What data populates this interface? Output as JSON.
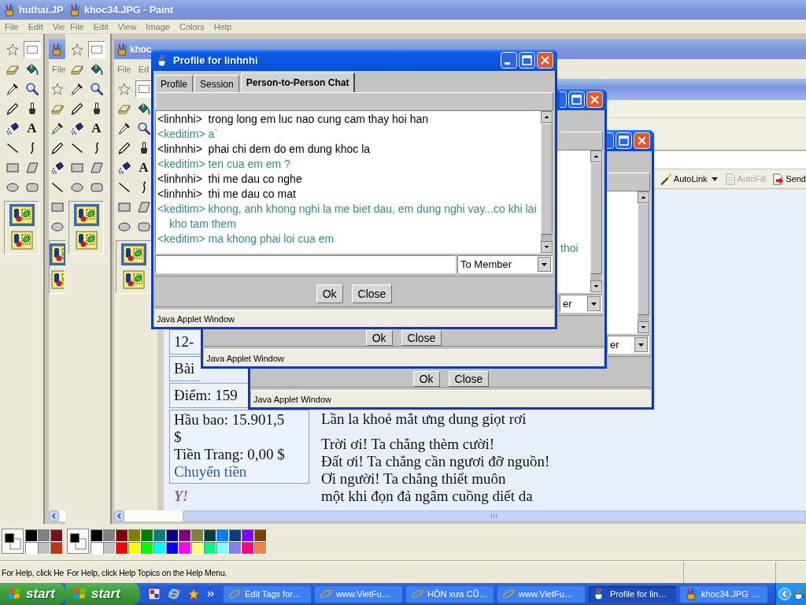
{
  "paint_windows": [
    {
      "title": "huthai.JP",
      "menu": [
        "File",
        "Edit",
        "Vie"
      ],
      "tools": [
        {
          "kind": "free-select",
          "selected": false
        },
        {
          "kind": "rect-select",
          "selected": true
        },
        {
          "kind": "eraser",
          "selected": false
        },
        {
          "kind": "fill",
          "selected": false
        },
        {
          "kind": "picker",
          "selected": false
        },
        {
          "kind": "magnifier",
          "selected": false
        },
        {
          "kind": "pencil",
          "selected": false
        },
        {
          "kind": "brush",
          "selected": false
        },
        {
          "kind": "airbrush",
          "selected": false
        },
        {
          "kind": "text",
          "glyph": "A",
          "selected": false
        },
        {
          "kind": "line",
          "selected": false
        },
        {
          "kind": "curve",
          "selected": false
        },
        {
          "kind": "rectangle",
          "selected": false
        },
        {
          "kind": "polygon",
          "selected": false
        },
        {
          "kind": "ellipse",
          "selected": false
        },
        {
          "kind": "rounded-rect",
          "selected": false
        }
      ],
      "options": [
        {
          "selected": true
        },
        {
          "selected": false
        }
      ],
      "nested_paint": {
        "menu": [
          "File"
        ],
        "tools": [
          {
            "kind": "free-select",
            "selected": false
          },
          {
            "kind": "eraser",
            "selected": false
          },
          {
            "kind": "picker",
            "selected": false
          },
          {
            "kind": "pencil",
            "selected": false
          },
          {
            "kind": "airbrush",
            "selected": false
          },
          {
            "kind": "line",
            "selected": false
          },
          {
            "kind": "rectangle",
            "selected": false
          },
          {
            "kind": "ellipse",
            "selected": false
          }
        ],
        "options": [
          {
            "selected": true
          },
          {
            "selected": false
          }
        ]
      },
      "palette": [
        {
          "color": "#000000"
        },
        {
          "color": "#808080"
        },
        {
          "color": "#701818"
        },
        {
          "color": "#ffffff"
        },
        {
          "color": "#c0c0c0"
        },
        {
          "color": "#c83214"
        }
      ],
      "status": "For Help, click He"
    },
    {
      "title": "khoc34.JPG - Paint",
      "menu": [
        "File",
        "Edit",
        "View",
        "Image",
        "Colors",
        "Help"
      ],
      "tools": [
        {
          "kind": "free-select",
          "selected": false
        },
        {
          "kind": "rect-select",
          "selected": true
        },
        {
          "kind": "eraser",
          "selected": false
        },
        {
          "kind": "fill",
          "selected": false
        },
        {
          "kind": "picker",
          "selected": false
        },
        {
          "kind": "magnifier",
          "selected": false
        },
        {
          "kind": "pencil",
          "selected": false
        },
        {
          "kind": "brush",
          "selected": false
        },
        {
          "kind": "airbrush",
          "selected": false
        },
        {
          "kind": "text",
          "glyph": "A",
          "selected": false
        },
        {
          "kind": "line",
          "selected": false
        },
        {
          "kind": "curve",
          "selected": false
        },
        {
          "kind": "rectangle",
          "selected": false
        },
        {
          "kind": "polygon",
          "selected": false
        },
        {
          "kind": "ellipse",
          "selected": false
        },
        {
          "kind": "rounded-rect",
          "selected": false
        }
      ],
      "options": [
        {
          "selected": true
        },
        {
          "selected": false
        }
      ],
      "nested_paint": {
        "title": "khoc",
        "menu": [
          "File",
          "Ed"
        ],
        "tools": [
          {
            "kind": "free-select",
            "selected": false
          },
          {
            "kind": "rect-select",
            "selected": true
          },
          {
            "kind": "eraser",
            "selected": false
          },
          {
            "kind": "fill",
            "selected": false
          },
          {
            "kind": "picker",
            "selected": false
          },
          {
            "kind": "magnifier",
            "selected": false
          },
          {
            "kind": "pencil",
            "selected": false
          },
          {
            "kind": "brush",
            "selected": false
          },
          {
            "kind": "airbrush",
            "selected": false
          },
          {
            "kind": "text",
            "glyph": "A",
            "selected": false
          },
          {
            "kind": "line",
            "selected": false
          },
          {
            "kind": "curve",
            "selected": false
          },
          {
            "kind": "rectangle",
            "selected": false
          },
          {
            "kind": "polygon",
            "selected": false
          },
          {
            "kind": "ellipse",
            "selected": false
          },
          {
            "kind": "rounded-rect",
            "selected": false
          }
        ],
        "options": [
          {
            "selected": true
          },
          {
            "selected": false
          }
        ],
        "browser": {
          "toolbar": [
            {
              "kind": "autolink",
              "label": "AutoLink",
              "disabled": false
            },
            {
              "kind": "autofill",
              "label": "AutoFill",
              "disabled": true
            },
            {
              "kind": "send",
              "label": "Send",
              "disabled": false
            }
          ],
          "sidebar": {
            "boxes": [
              "12-",
              "Bài",
              "Điểm: 159"
            ],
            "wallet": [
              "Hầu bao: 15.901,5",
              "$",
              "Tiền Trang: 0,00 $"
            ],
            "link": "Chuyển tiền",
            "logo": "Y!"
          },
          "poem": [
            [
              "Lần la khoẻ mắt ưng dung giọt rơi"
            ],
            [
              "Trời ơi! Ta chẳng thèm cười!",
              "Đất ơi! Ta chẳng cần ngươi đỡ nguồn!",
              "Ơi người! Ta chẳng thiết muôn",
              "một khi đọn đả ngâm cuồng diết da"
            ]
          ]
        }
      },
      "palette": [
        {
          "color": "#000000"
        },
        {
          "color": "#808080"
        },
        {
          "color": "#800000"
        },
        {
          "color": "#808000"
        },
        {
          "color": "#008000"
        },
        {
          "color": "#008080"
        },
        {
          "color": "#000080"
        },
        {
          "color": "#800080"
        },
        {
          "color": "#808040"
        },
        {
          "color": "#004040"
        },
        {
          "color": "#0080ff"
        },
        {
          "color": "#004080"
        },
        {
          "color": "#8000ff"
        },
        {
          "color": "#804000"
        },
        {
          "color": "#ffffff"
        },
        {
          "color": "#c0c0c0"
        },
        {
          "color": "#ff0000"
        },
        {
          "color": "#ffff00"
        },
        {
          "color": "#00ff00"
        },
        {
          "color": "#00ffff"
        },
        {
          "color": "#0000ff"
        },
        {
          "color": "#ff00ff"
        },
        {
          "color": "#ffff80"
        },
        {
          "color": "#00ff80"
        },
        {
          "color": "#80ffff"
        },
        {
          "color": "#8080ff"
        },
        {
          "color": "#ff0080"
        },
        {
          "color": "#ff8040"
        }
      ],
      "status": "For Help, click Help Topics on the Help Menu."
    }
  ],
  "java_windows": [
    {
      "kind": "dialog",
      "title": "Profile for linhnhi",
      "tabs": [
        {
          "label": "Profile",
          "selected": false
        },
        {
          "label": "Session",
          "selected": false
        },
        {
          "label": "Person-to-Person Chat",
          "selected": true
        }
      ],
      "messages": [
        {
          "text": "<linhnhi>  trong long em luc nao cung cam thay hoi han",
          "color": "#000000"
        },
        {
          "text": "<keditim> a`",
          "color": "#338a8a"
        },
        {
          "text": "<linhnhi>  phai chi dem do em dung khoc la",
          "color": "#000000"
        },
        {
          "text": "<keditim> ten cua em em ?",
          "color": "#338a8a"
        },
        {
          "text": "<linhnhi>  thi me dau co nghe",
          "color": "#000000"
        },
        {
          "text": "<linhnhi>  thi me dau co mat",
          "color": "#000000"
        },
        {
          "text": "<keditim> khong, anh khong nghi la me biet dau, em dung nghi vay...co khi lai kho tam them",
          "color": "#338a8a"
        },
        {
          "text": "<keditim> ma khong phai loi cua em",
          "color": "#338a8a"
        }
      ],
      "recipient": "To Member",
      "buttons": [
        "Ok",
        "Close"
      ],
      "status": "Java Applet Window"
    },
    {
      "kind": "dialog-behind",
      "messages": [
        {
          "text": "thoi",
          "color": "#338a8a"
        }
      ],
      "recipient": "er",
      "buttons": [
        "Ok",
        "Close"
      ],
      "status": "Java Applet Window"
    },
    {
      "kind": "dialog-behind",
      "recipient": "er",
      "buttons": [
        "Ok",
        "Close"
      ],
      "status": "Java Applet Window"
    }
  ],
  "taskbar": {
    "start_buttons": [
      "start",
      "start"
    ],
    "tasks": [
      {
        "kind": "browser",
        "label": "Edit Tags for…",
        "selected": false
      },
      {
        "kind": "browser",
        "label": "www.VietFu…",
        "selected": false
      },
      {
        "kind": "browser",
        "label": "HÔN xưa CŨ…",
        "selected": false
      },
      {
        "kind": "browser",
        "label": "www.VietFu…",
        "selected": false
      },
      {
        "kind": "java",
        "label": "Profile for lin…",
        "selected": true
      },
      {
        "kind": "paint",
        "label": "khoc34.JPG …",
        "selected": false
      }
    ]
  }
}
